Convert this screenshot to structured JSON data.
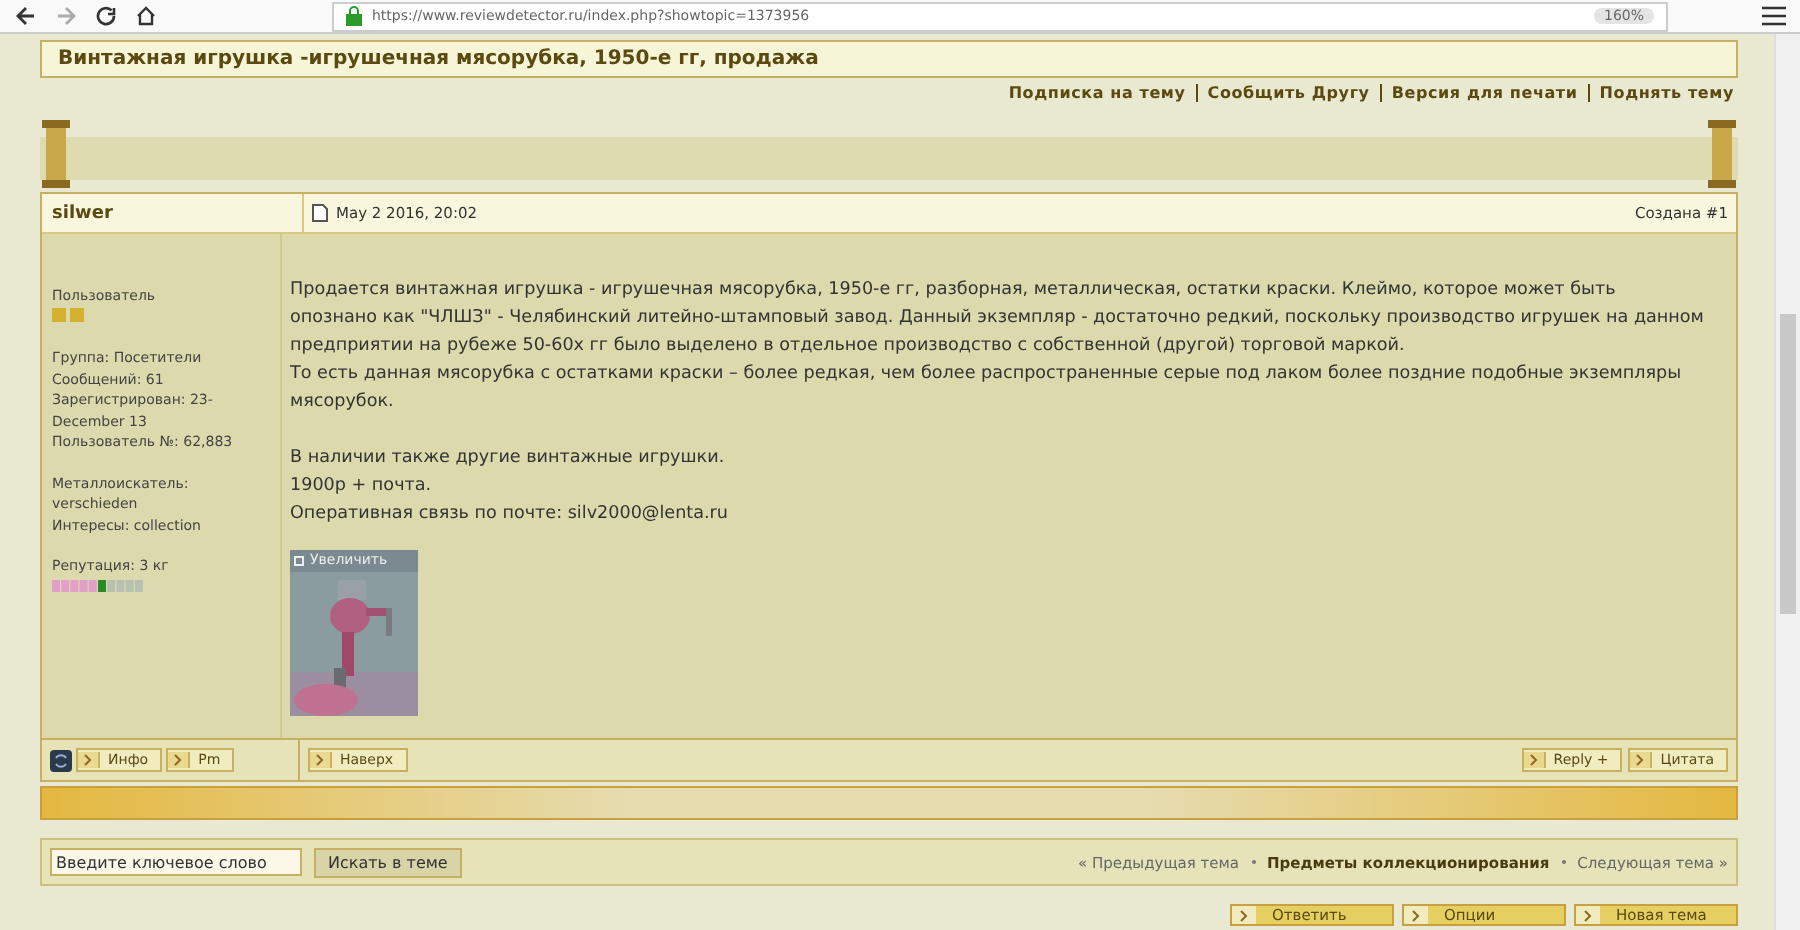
{
  "browser": {
    "url": "https://www.reviewdetector.ru/index.php?showtopic=1373956",
    "zoom": "160%"
  },
  "topic": {
    "title": "Винтажная игрушка -игрушечная мясорубка, 1950-е гг, продажа",
    "links": [
      "Подписка на тему",
      "Сообщить Другу",
      "Версия для печати",
      "Поднять тему"
    ]
  },
  "post": {
    "author": "silwer",
    "date": "May 2 2016, 20:02",
    "number": "Создана #1",
    "profile": {
      "rank": "Пользователь",
      "info": [
        "Группа: Посетители",
        "Сообщений: 61",
        "Зарегистрирован: 23-December 13",
        "Пользователь №: 62,883"
      ],
      "extra": [
        "Металлоискатель: verschieden",
        "Интересы: collection"
      ],
      "reputation": "Репутация: 3 кг"
    },
    "blocks": [
      [
        "Продается винтажная игрушка - игрушечная мясорубка, 1950-е гг, разборная, металлическая, остатки краски. Клеймо, которое может быть опознано как \"ЧЛШЗ\" - Челябинский литейно-штамповый завод. Данный экземпляр - достаточно редкий, поскольку производство игрушек на данном предприятии на рубеже 50-60х гг было выделено в отдельное производство с собственной (другой) торговой маркой.",
        "То есть данная мясорубка с остатками краски – более редкая, чем более распространенные серые под лаком более поздние подобные экземпляры мясорубок."
      ],
      [
        "В наличии также другие винтажные игрушки.",
        "1900р + почта.",
        "Оперативная связь по почте: silv2000@lenta.ru"
      ]
    ],
    "image": {
      "kind": "picture",
      "caption": "Увеличить"
    },
    "author_buttons": [
      "Инфо",
      "Pm"
    ],
    "top_button": "Наверх",
    "action_buttons": [
      "Reply +",
      "Цитата"
    ]
  },
  "search": {
    "placeholder": "Введите ключевое слово",
    "button": "Искать в теме"
  },
  "nav": {
    "prev": "« Предыдущая тема",
    "forum": "Предметы коллекционирования",
    "next": "Следующая тема »"
  },
  "bottom_buttons": [
    "Ответить",
    "Опции",
    "Новая тема"
  ]
}
